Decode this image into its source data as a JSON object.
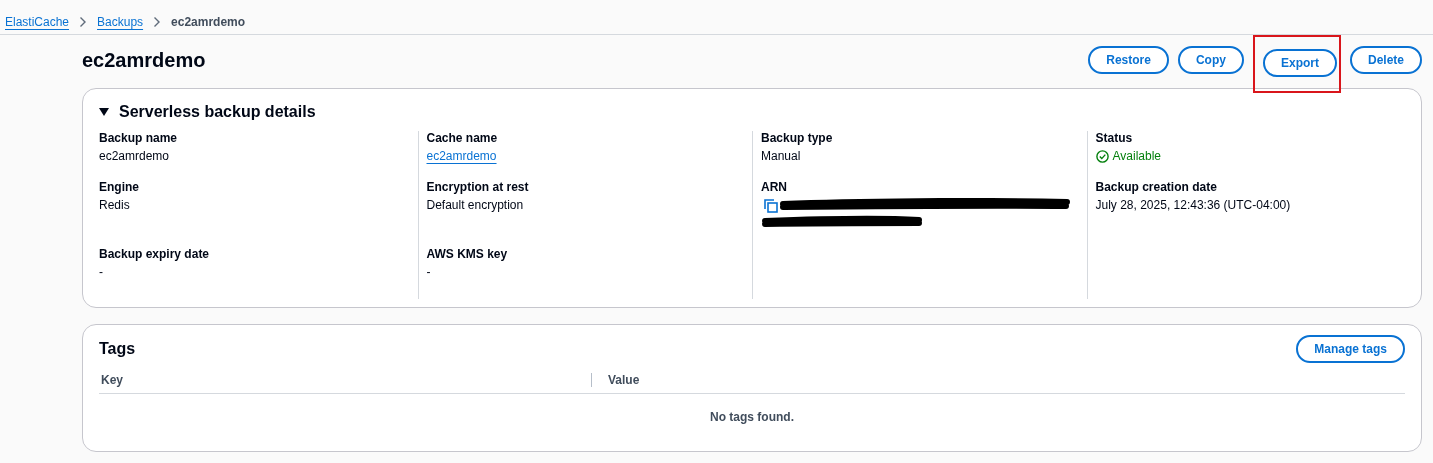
{
  "breadcrumbs": [
    {
      "label": "ElastiCache",
      "kind": "link"
    },
    {
      "label": "Backups",
      "kind": "link"
    },
    {
      "label": "ec2amrdemo",
      "kind": "current"
    }
  ],
  "page": {
    "title": "ec2amrdemo",
    "actions": [
      {
        "label": "Restore",
        "highlighted": false
      },
      {
        "label": "Copy",
        "highlighted": false
      },
      {
        "label": "Export",
        "highlighted": true
      },
      {
        "label": "Delete",
        "highlighted": false
      }
    ]
  },
  "details": {
    "title": "Serverless backup details",
    "expanded": true,
    "columns": [
      [
        {
          "label": "Backup name",
          "kind": "text",
          "value": "ec2amrdemo"
        },
        {
          "label": "Engine",
          "kind": "text",
          "value": "Redis"
        },
        {
          "label": "Backup expiry date",
          "kind": "text",
          "value": "-"
        }
      ],
      [
        {
          "label": "Cache name",
          "kind": "link",
          "value": "ec2amrdemo"
        },
        {
          "label": "Encryption at rest",
          "kind": "text",
          "value": "Default encryption"
        },
        {
          "label": "AWS KMS key",
          "kind": "text",
          "value": "-"
        }
      ],
      [
        {
          "label": "Backup type",
          "kind": "text",
          "value": "Manual"
        },
        {
          "label": "ARN",
          "kind": "redacted"
        }
      ],
      [
        {
          "label": "Status",
          "kind": "status",
          "value": "Available"
        },
        {
          "label": "Backup creation date",
          "kind": "text",
          "value": "July 28, 2025, 12:43:36 (UTC-04:00)"
        }
      ]
    ]
  },
  "tags": {
    "title": "Tags",
    "action": "Manage tags",
    "columns": [
      "Key",
      "Value"
    ],
    "empty_text": "No tags found."
  }
}
